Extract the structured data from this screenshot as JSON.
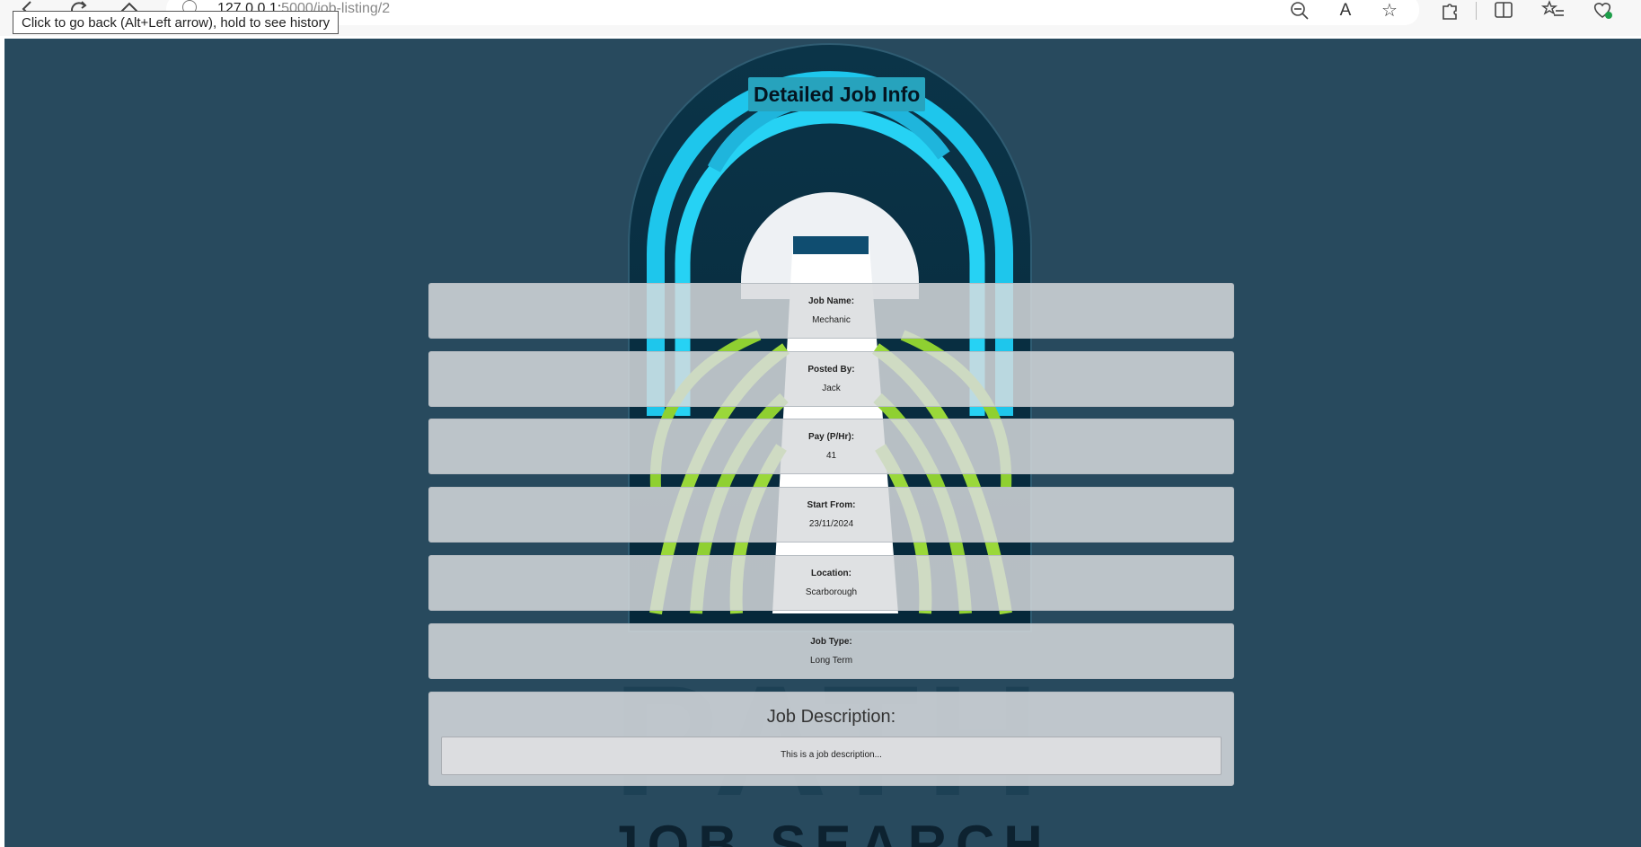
{
  "browser": {
    "url_host": "127.0.0.1:",
    "url_path": "5000/job-listing/2",
    "tooltip": "Click to go back (Alt+Left arrow), hold to see history",
    "icons": [
      "back-icon",
      "refresh-icon",
      "home-icon",
      "info-icon",
      "zoom-out-icon",
      "read-aloud-icon",
      "favorite-star-icon",
      "extensions-icon",
      "split-screen-icon",
      "favorites-list-icon",
      "browser-essentials-icon"
    ]
  },
  "page": {
    "title": "Detailed Job Info",
    "background_color": "#284a5e",
    "title_bg_color": "#27a3bd",
    "fields": [
      {
        "label": "Job Name:",
        "value": "Mechanic"
      },
      {
        "label": "Posted By:",
        "value": "Jack"
      },
      {
        "label": "Pay (P/Hr):",
        "value": "41"
      },
      {
        "label": "Start From:",
        "value": "23/11/2024"
      },
      {
        "label": "Location:",
        "value": "Scarborough"
      },
      {
        "label": "Job Type:",
        "value": "Long Term"
      }
    ],
    "description": {
      "label": "Job Description:",
      "text": "This is a job description..."
    },
    "logo": {
      "line1": "PATH",
      "line2": "JOB SEARCH"
    }
  }
}
